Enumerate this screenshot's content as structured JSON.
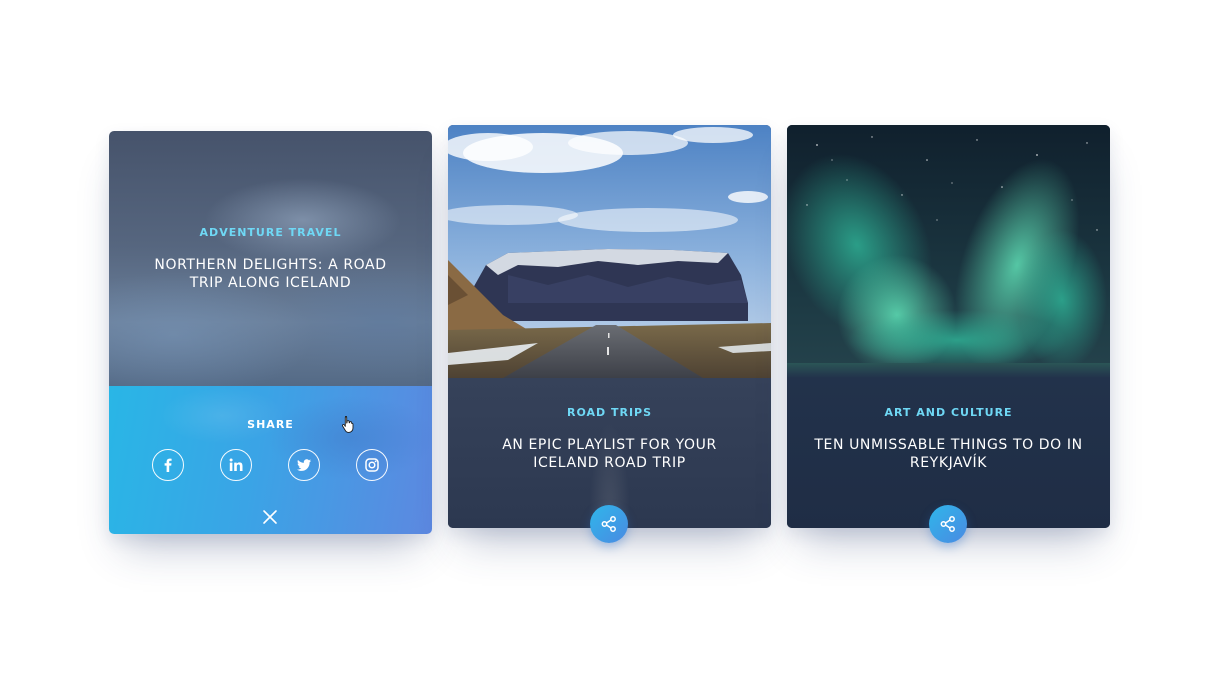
{
  "cards": [
    {
      "category": "ADVENTURE TRAVEL",
      "title": "NORTHERN DELIGHTS: A ROAD TRIP ALONG ICELAND",
      "share_label": "SHARE",
      "social": [
        "facebook-icon",
        "linkedin-icon",
        "twitter-icon",
        "instagram-icon"
      ]
    },
    {
      "category": "ROAD TRIPS",
      "title": "AN EPIC PLAYLIST FOR YOUR ICELAND ROAD TRIP"
    },
    {
      "category": "ART AND CULTURE",
      "title": "TEN UNMISSABLE THINGS TO DO IN REYKJAVÍK"
    }
  ],
  "colors": {
    "category_accent": "#6fd8f5",
    "share_gradient_start": "#2fb6ea",
    "share_gradient_end": "#4a8ae2"
  }
}
